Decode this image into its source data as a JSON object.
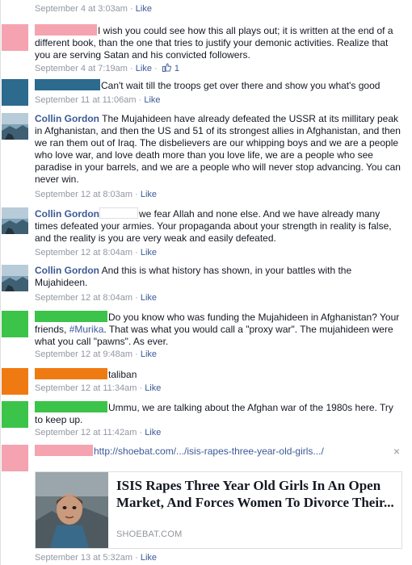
{
  "top_meta": {
    "timestamp": "September 4 at 3:03am",
    "like": "Like"
  },
  "comments": [
    {
      "avatar_color": "#f5a3b0",
      "redact_color": "#f5a3b0",
      "text": "I wish you could see how this all plays out; it is written at the end of a different book, than the one that tries to justify your demonic activities. Realize that you are serving Satan and his convicted followers.",
      "timestamp": "September 4 at 7:19am",
      "like": "Like",
      "like_count": "1"
    },
    {
      "avatar_color": "#2c6b8e",
      "redact_color": "#2c6b8e",
      "text": "Can't wait till the troops get over there and show you what's good",
      "timestamp": "September 11 at 11:06am",
      "like": "Like"
    },
    {
      "author": "Collin Gordon",
      "text": "The Mujahideen have already defeated the USSR at its millitary peak in Afghanistan, and then the US and 51 of its strongest allies in Afghanistan, and then we ran them out of Iraq. The disbelievers are our whipping boys and we are a people who love war, and love death more than you love life, we are a people who see paradise in your barrels, and we are a people who will never stop advancing. You can never win.",
      "timestamp": "September 12 at 8:03am",
      "like": "Like"
    },
    {
      "author": "Collin Gordon",
      "text": "we fear Allah and none else. And we have already many times defeated your armies. Your propaganda about your strength in reality is false, and the reality is you are very weak and easily defeated.",
      "timestamp": "September 12 at 8:04am",
      "like": "Like"
    },
    {
      "author": "Collin Gordon",
      "text": "And this is what history has shown, in your battles with the Mujahideen.",
      "timestamp": "September 12 at 8:04am",
      "like": "Like"
    },
    {
      "avatar_color": "#3cc34a",
      "redact_color": "#3cc34a",
      "text_a": "Do you know who was funding the Mujahideen in Afghanistan? Your friends, ",
      "hashtag": "#Murika",
      "text_b": ". That was what you would call a \"proxy war\". The mujahideen were what you call \"pawns\". As ever.",
      "timestamp": "September 12 at 9:48am",
      "like": "Like"
    },
    {
      "avatar_color": "#f07a12",
      "redact_color": "#f07a12",
      "text": "taliban",
      "timestamp": "September 12 at 11:34am",
      "like": "Like"
    },
    {
      "avatar_color": "#3cc34a",
      "redact_color": "#3cc34a",
      "text": "Ummu, we are talking about the Afghan war of the 1980s here. Try to keep up.",
      "timestamp": "September 12 at 11:42am",
      "like": "Like"
    },
    {
      "avatar_color": "#f5a3b0",
      "redact_color": "#f5a3b0",
      "link": "http://shoebat.com/.../isis-rapes-three-year-old-girls.../",
      "close": "×",
      "card": {
        "title": "ISIS Rapes Three Year Old Girls In An Open Market, And Forces Women To Divorce Their...",
        "source": "SHOEBAT.COM"
      },
      "timestamp": "September 13 at 5:32am",
      "like": "Like"
    }
  ]
}
